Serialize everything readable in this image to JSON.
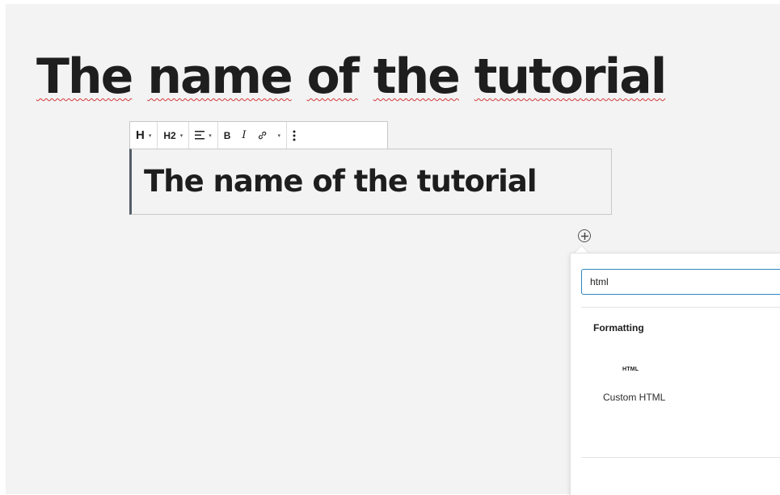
{
  "post": {
    "title_words": [
      "The",
      "name",
      "of",
      "the",
      "tutorial"
    ]
  },
  "toolbar": {
    "transform_label": "H",
    "heading_level": "H2",
    "caret": "▾",
    "align_icon": "align-left-icon",
    "bold_label": "B",
    "italic_label": "I",
    "link_icon": "link-icon",
    "more_icon": "vertical-ellipsis-icon"
  },
  "heading_block": {
    "text": "The name of the tutorial"
  },
  "inserter": {
    "search_value": "html",
    "section_title": "Formatting",
    "blocks": [
      {
        "icon_text": "HTML",
        "label": "Custom HTML"
      }
    ]
  },
  "colors": {
    "canvas": "#f3f3f3",
    "text": "#1e1e1e",
    "focus": "#2e86c1",
    "spellcheck": "#d63638"
  }
}
